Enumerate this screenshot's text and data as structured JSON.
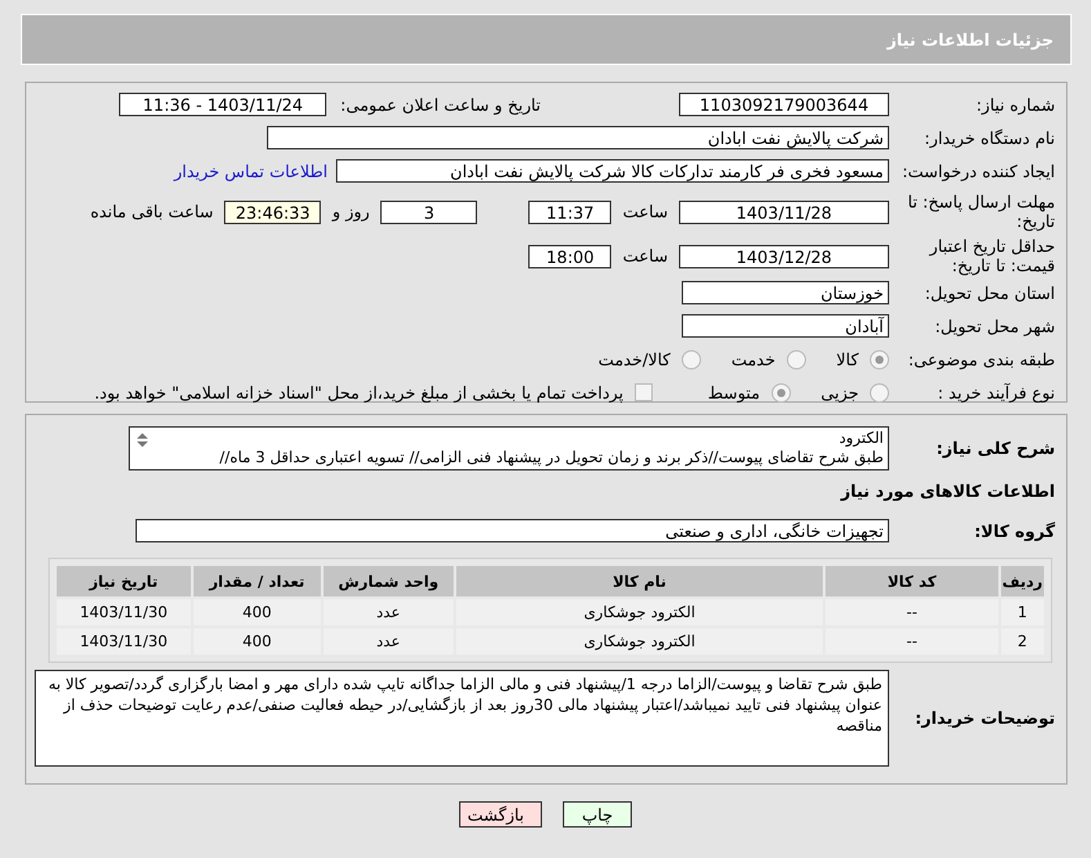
{
  "header": {
    "title": "جزئیات اطلاعات نیاز"
  },
  "need_number": {
    "label": "شماره نیاز:",
    "value": "1103092179003644"
  },
  "announce": {
    "label": "تاریخ و ساعت اعلان عمومی:",
    "value": "1403/11/24 - 11:36"
  },
  "buyer_org": {
    "label": "نام دستگاه خریدار:",
    "value": "شرکت پالایش نفت ابادان"
  },
  "requester": {
    "label": "ایجاد کننده درخواست:",
    "value": "مسعود فخری فر کارمند تدارکات کالا شرکت پالایش نفت ابادان",
    "contact_link": "اطلاعات تماس خریدار"
  },
  "response_deadline": {
    "label": "مهلت ارسال پاسخ: تا تاریخ:",
    "date": "1403/11/28",
    "time_label": "ساعت",
    "time": "11:37",
    "days": "3",
    "days_label": "روز و",
    "remaining": "23:46:33",
    "remaining_label": "ساعت باقی مانده"
  },
  "price_validity": {
    "label": "حداقل تاریخ اعتبار قیمت: تا تاریخ:",
    "date": "1403/12/28",
    "time_label": "ساعت",
    "time": "18:00"
  },
  "province": {
    "label": "استان محل تحویل:",
    "value": "خوزستان"
  },
  "city": {
    "label": "شهر محل تحویل:",
    "value": "آبادان"
  },
  "category": {
    "label": "طبقه بندی موضوعی:",
    "options": [
      {
        "label": "کالا",
        "selected": true
      },
      {
        "label": "خدمت",
        "selected": false
      },
      {
        "label": "کالا/خدمت",
        "selected": false
      }
    ]
  },
  "purchase_type": {
    "label": "نوع فرآیند خرید :",
    "options": [
      {
        "label": "جزیی",
        "selected": false
      },
      {
        "label": "متوسط",
        "selected": true
      }
    ],
    "payment_checkbox": {
      "label": "پرداخت تمام یا بخشی از مبلغ خرید،از محل \"اسناد خزانه اسلامی\" خواهد بود.",
      "checked": false
    }
  },
  "description": {
    "label": "شرح کلی نیاز:",
    "lines": [
      "الکترود",
      "طبق شرح تقاضای پیوست//ذکر برند و زمان تحویل در پیشنهاد فنی الزامی// تسویه اعتباری حداقل 3 ماه//"
    ]
  },
  "goods_heading": "اطلاعات کالاهای مورد نیاز",
  "goods_group": {
    "label": "گروه کالا:",
    "value": "تجهیزات خانگی، اداری و صنعتی"
  },
  "table": {
    "columns": [
      "ردیف",
      "کد کالا",
      "نام کالا",
      "واحد شمارش",
      "تعداد / مقدار",
      "تاریخ نیاز"
    ],
    "rows": [
      [
        "1",
        "--",
        "الکترود جوشکاری",
        "عدد",
        "400",
        "1403/11/30"
      ],
      [
        "2",
        "--",
        "الکترود جوشکاری",
        "عدد",
        "400",
        "1403/11/30"
      ]
    ]
  },
  "buyer_notes": {
    "label": "توضیحات خریدار:",
    "text": "طبق شرح تقاضا و پیوست/الزاما درجه 1/پیشنهاد فنی و مالی الزاما جداگانه تایپ شده دارای مهر و امضا بارگزاری گردد/تصویر کالا به عنوان پیشنهاد فنی تایید نمیباشد/اعتبار پیشنهاد مالی 30روز بعد از بازگشایی/در حیطه فعالیت صنفی/عدم رعایت توضیحات حذف از مناقصه"
  },
  "buttons": [
    {
      "label": "چاپ",
      "kind": "print"
    },
    {
      "label": "بازگشت",
      "kind": "back"
    }
  ]
}
